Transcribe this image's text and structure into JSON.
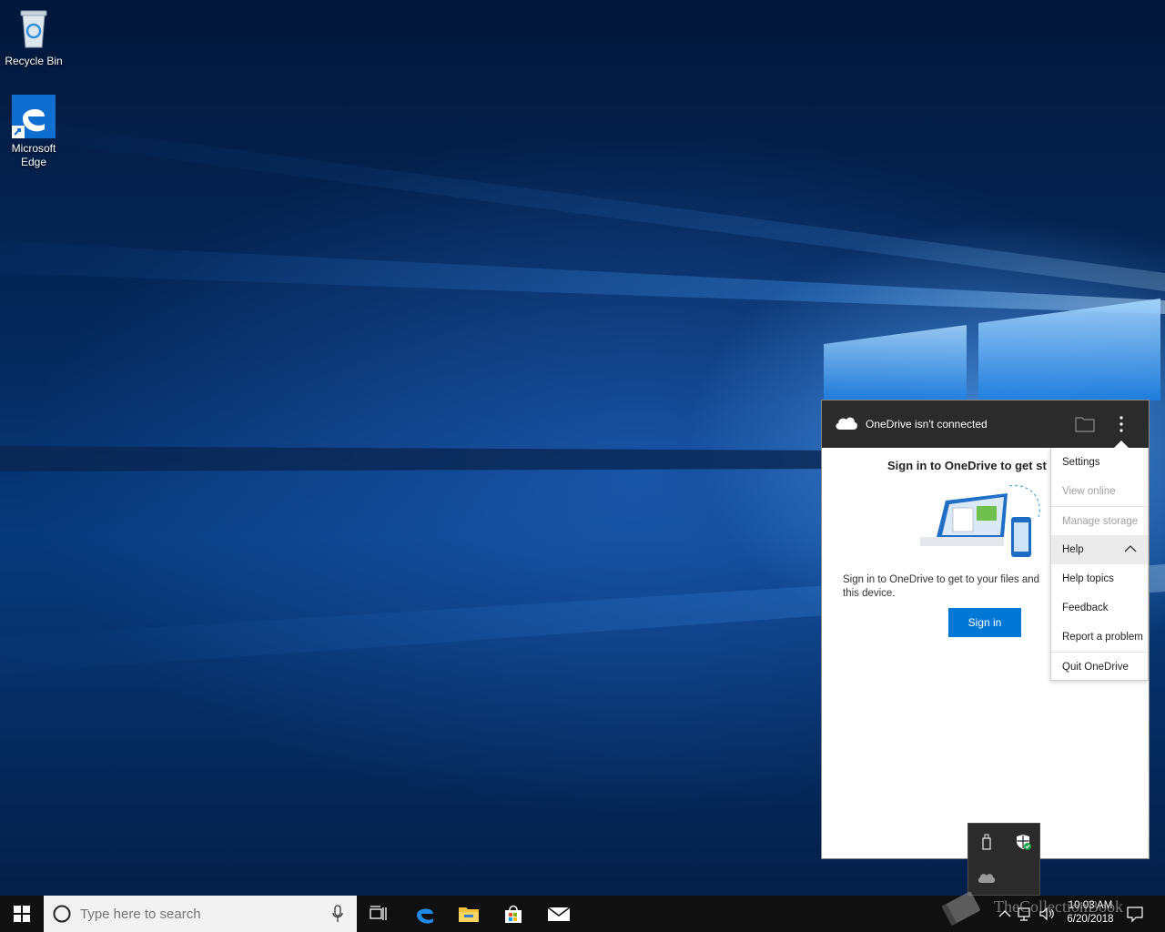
{
  "desktop": {
    "icons": [
      {
        "label": "Recycle Bin",
        "icon": "recycle-bin-icon"
      },
      {
        "label": "Microsoft Edge",
        "icon": "edge-icon"
      }
    ]
  },
  "onedrive": {
    "header_title": "OneDrive isn't connected",
    "heading": "Sign in to OneDrive to get st",
    "body_text": "Sign in to OneDrive to get to your files and this device.",
    "signin_label": "Sign in",
    "colors": {
      "header_bg": "#2b2b2b",
      "accent": "#0078d7"
    }
  },
  "menu": {
    "items": [
      {
        "label": "Settings",
        "enabled": true
      },
      {
        "label": "View online",
        "enabled": false
      },
      {
        "label": "Manage storage",
        "enabled": false
      },
      {
        "label": "Help",
        "enabled": true,
        "expanded": true
      },
      {
        "label": "Help topics",
        "enabled": true
      },
      {
        "label": "Feedback",
        "enabled": true
      },
      {
        "label": "Report a problem",
        "enabled": true
      },
      {
        "label": "Quit OneDrive",
        "enabled": true
      }
    ]
  },
  "taskbar": {
    "search_placeholder": "Type here to search",
    "apps": [
      "task-view-icon",
      "edge-icon",
      "file-explorer-icon",
      "store-icon",
      "mail-icon"
    ],
    "clock_time": "10:03 AM",
    "clock_date": "6/20/2018"
  },
  "tray_overflow": {
    "icons": [
      "usb-device-icon",
      "windows-defender-icon",
      "onedrive-icon"
    ]
  },
  "watermark": {
    "text": "TheCollectionBook"
  }
}
